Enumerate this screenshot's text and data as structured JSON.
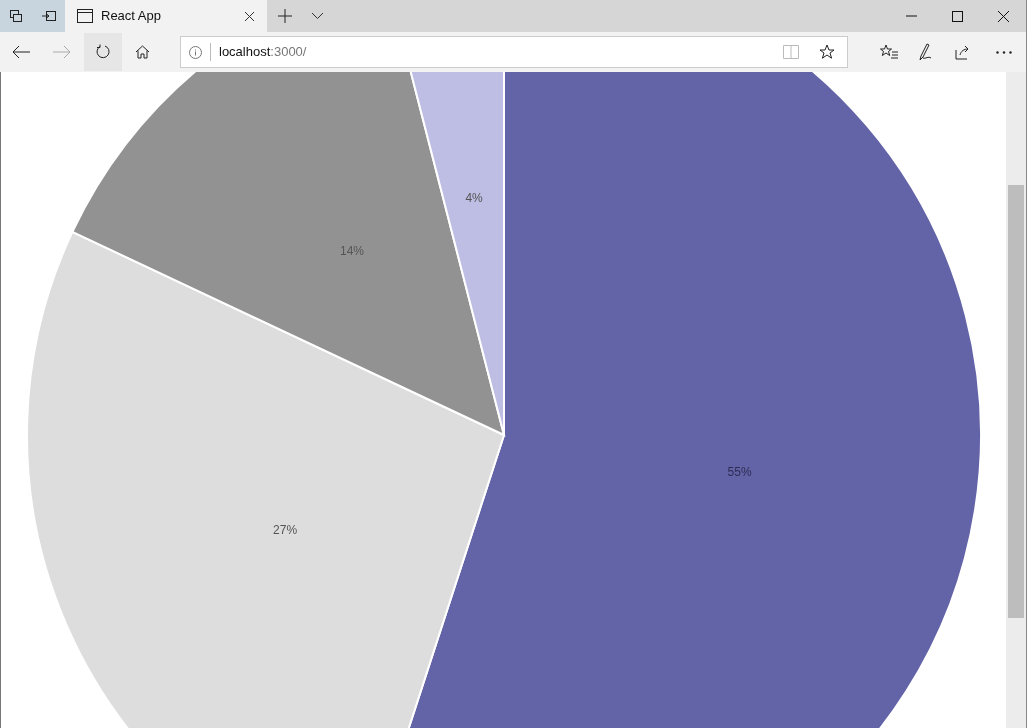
{
  "tab": {
    "title": "React App",
    "selected": true
  },
  "address_bar": {
    "host": "localhost",
    "rest": ":3000/"
  },
  "page": {
    "chart_data": {
      "type": "pie",
      "values": [
        55,
        27,
        14,
        4
      ],
      "value_labels": [
        "55%",
        "27%",
        "14%",
        "4%"
      ]
    },
    "slices": [
      {
        "color": "#6363a8"
      },
      {
        "color": "#dddddd"
      },
      {
        "color": "#929292"
      },
      {
        "color": "#bebee4"
      }
    ]
  }
}
